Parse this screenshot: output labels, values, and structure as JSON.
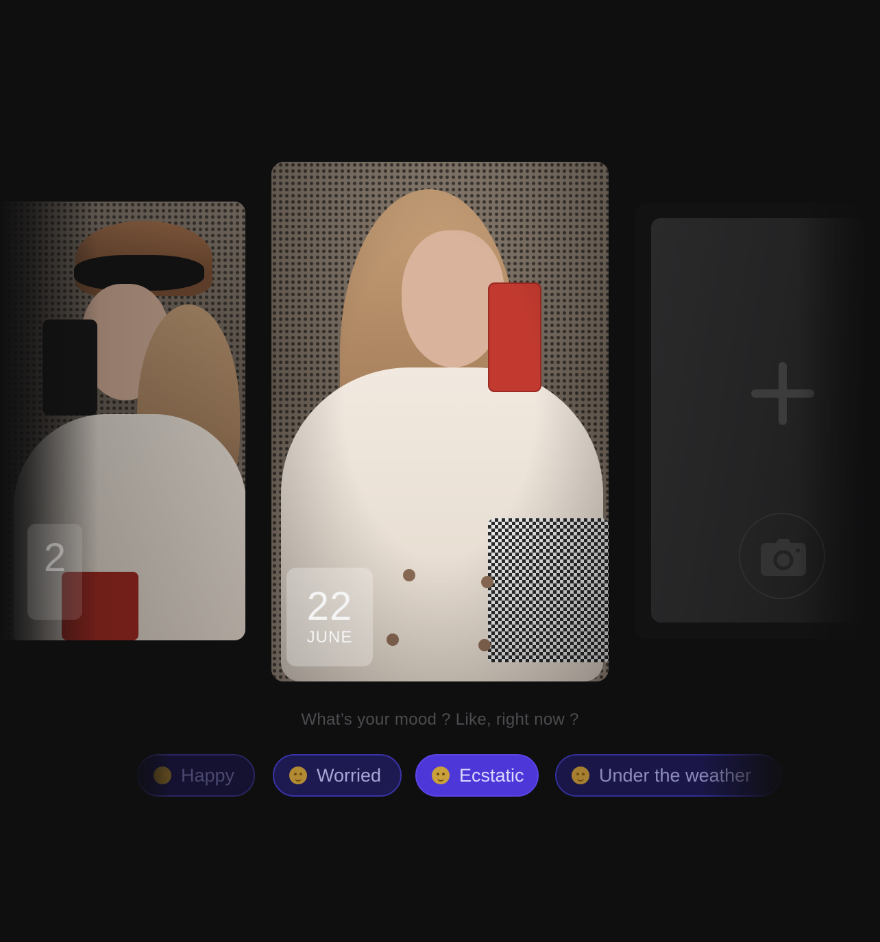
{
  "cards": {
    "left": {
      "date_day": "2"
    },
    "center": {
      "date_day": "22",
      "date_month": "JUNE"
    },
    "right": {
      "add_icon": "plus-icon",
      "camera_icon": "camera-icon"
    }
  },
  "mood": {
    "prompt": "What’s your mood ? Like, right now ?",
    "options": [
      {
        "label": "Happy",
        "icon": "smile-emoji"
      },
      {
        "label": "Worried",
        "icon": "pensive-emoji"
      },
      {
        "label": "Ecstatic",
        "icon": "grin-emoji"
      },
      {
        "label": "Under the weather",
        "icon": "sick-emoji"
      }
    ],
    "selected": "Ecstatic"
  },
  "colors": {
    "background": "#0f0f10",
    "accent": "#4d37d9",
    "chip_dark": "#1d1a52",
    "chip_border": "#3a33a6"
  }
}
